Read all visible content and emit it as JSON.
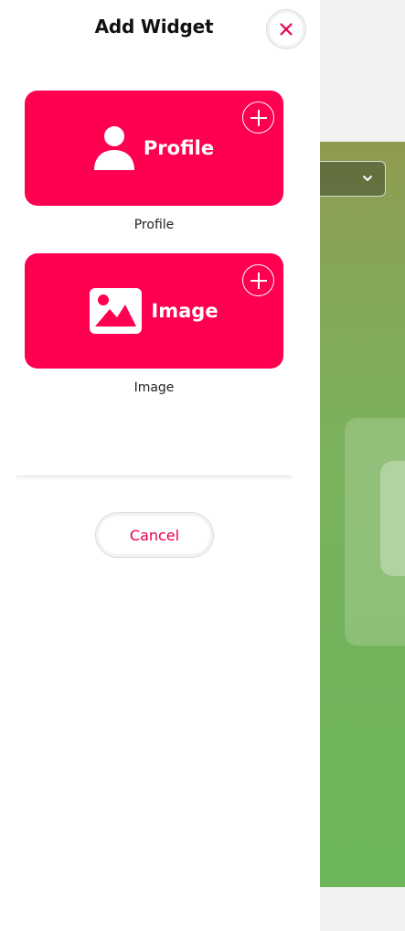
{
  "drawer": {
    "title": "Add Widget",
    "close_icon": "close-icon",
    "cancel_label": "Cancel"
  },
  "widgets": [
    {
      "title": "Profile",
      "caption": "Profile",
      "icon": "person-icon",
      "add_icon": "plus-circle-icon"
    },
    {
      "title": "Image",
      "caption": "Image",
      "icon": "image-icon",
      "add_icon": "plus-circle-icon"
    }
  ],
  "colors": {
    "accent": "#ff0050",
    "cancel_text": "#e8004b",
    "close_x": "#e8004b"
  }
}
